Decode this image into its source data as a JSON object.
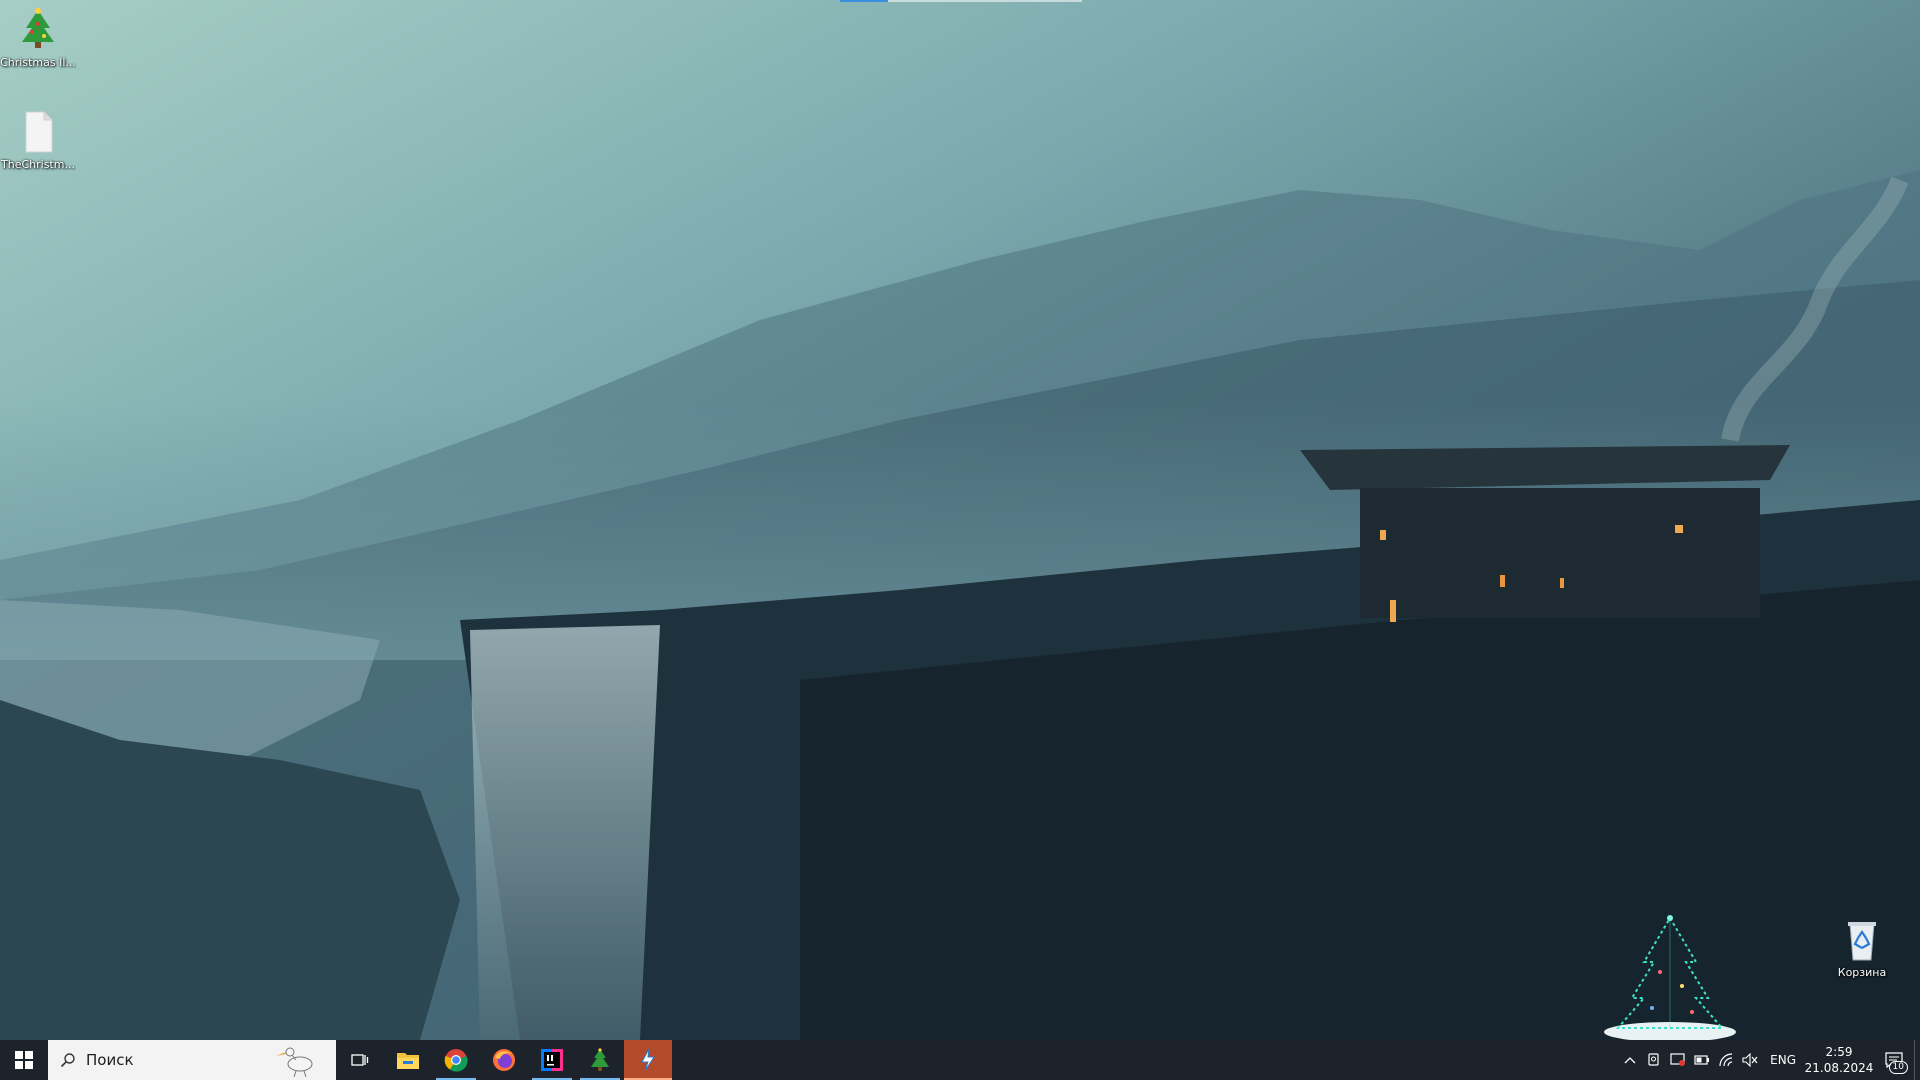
{
  "desktop": {
    "icons": [
      {
        "label": "Christmas Il...",
        "icon": "christmas-tree-icon"
      },
      {
        "label": "TheChristm...",
        "icon": "blank-file-icon"
      },
      {
        "label": "Корзина",
        "icon": "recycle-bin-icon"
      }
    ],
    "download_progress": 0.2
  },
  "taskbar": {
    "search": {
      "placeholder": "Поиск"
    },
    "apps": [
      {
        "name": "task-view",
        "icon": "task-view-icon"
      },
      {
        "name": "file-explorer",
        "icon": "folder-icon"
      },
      {
        "name": "chrome",
        "icon": "chrome-icon"
      },
      {
        "name": "firefox",
        "icon": "firefox-icon"
      },
      {
        "name": "intellij",
        "icon": "intellij-icon"
      },
      {
        "name": "christmas-tree",
        "icon": "christmas-tree-icon"
      },
      {
        "name": "lightning-app",
        "icon": "lightning-icon"
      }
    ],
    "tray": {
      "language": "ENG",
      "time": "2:59",
      "date": "21.08.2024",
      "notification_count": "10"
    }
  },
  "colors": {
    "taskbar_bg": "#1c232b",
    "active_indicator": "#76b9ed",
    "focused_app": "#b34a2a"
  }
}
